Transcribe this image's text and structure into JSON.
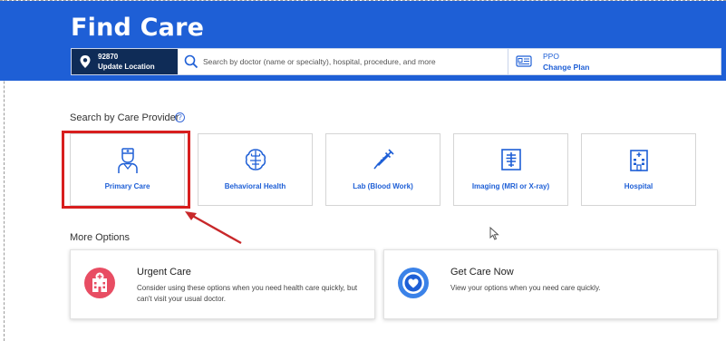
{
  "header": {
    "title": "Find Care",
    "location": {
      "zip": "92870",
      "action": "Update Location"
    },
    "search": {
      "placeholder": "Search by doctor (name or specialty), hospital, procedure, and more"
    },
    "plan": {
      "type": "PPO",
      "action": "Change Plan"
    }
  },
  "providers": {
    "label": "Search by Care Provider",
    "help_glyph": "?",
    "items": [
      {
        "label": "Primary Care",
        "icon": "doctor-icon"
      },
      {
        "label": "Behavioral Health",
        "icon": "brain-icon"
      },
      {
        "label": "Lab (Blood Work)",
        "icon": "syringe-icon"
      },
      {
        "label": "Imaging (MRI or X-ray)",
        "icon": "xray-icon"
      },
      {
        "label": "Hospital",
        "icon": "hospital-icon"
      }
    ]
  },
  "more_options": {
    "label": "More Options",
    "items": [
      {
        "title": "Urgent Care",
        "description_1": "Consider using these options when you need health care quickly, but",
        "description_2": "can't visit your usual doctor.",
        "icon": "urgent-care-icon"
      },
      {
        "title": "Get Care Now",
        "description_1": "View your options when you need care quickly.",
        "description_2": "",
        "icon": "heart-icon"
      }
    ]
  },
  "colors": {
    "brand": "#1e5fd6",
    "dark": "#0f2c57",
    "highlight": "#d81e1e",
    "urgent": "#e84d63"
  }
}
